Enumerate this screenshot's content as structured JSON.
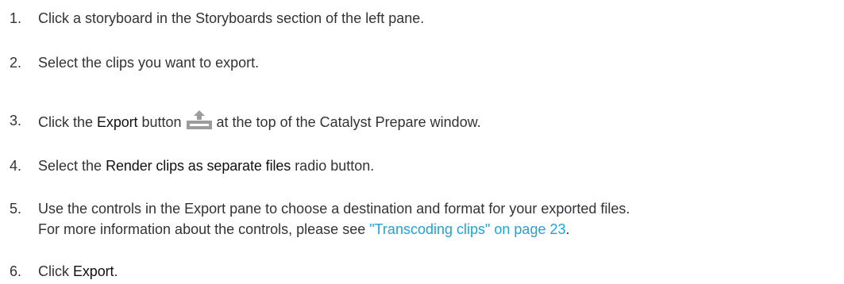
{
  "steps": [
    {
      "num": "1.",
      "text": "Click a storyboard in the Storyboards section of the left pane."
    },
    {
      "num": "2.",
      "text": "Select the clips you want to export."
    },
    {
      "num": "3.",
      "pre": "Click the ",
      "bold": "Export",
      "mid": " button",
      "icon": "export-upload-icon",
      "post": "at the top of the Catalyst Prepare window."
    },
    {
      "num": "4.",
      "pre": "Select the ",
      "bold": "Render clips as separate files",
      "post": " radio button."
    },
    {
      "num": "5.",
      "line1": "Use the controls in the Export pane to choose a destination and format for your exported files.",
      "line2_pre": "For more information about the controls, please see ",
      "link": "\"Transcoding clips\" on page 23",
      "line2_post": "."
    },
    {
      "num": "6.",
      "pre": "Click ",
      "bold": "Export",
      "post": "."
    }
  ],
  "colors": {
    "text": "#333333",
    "link": "#1fa3d6",
    "icon": "#9c9c9c"
  }
}
